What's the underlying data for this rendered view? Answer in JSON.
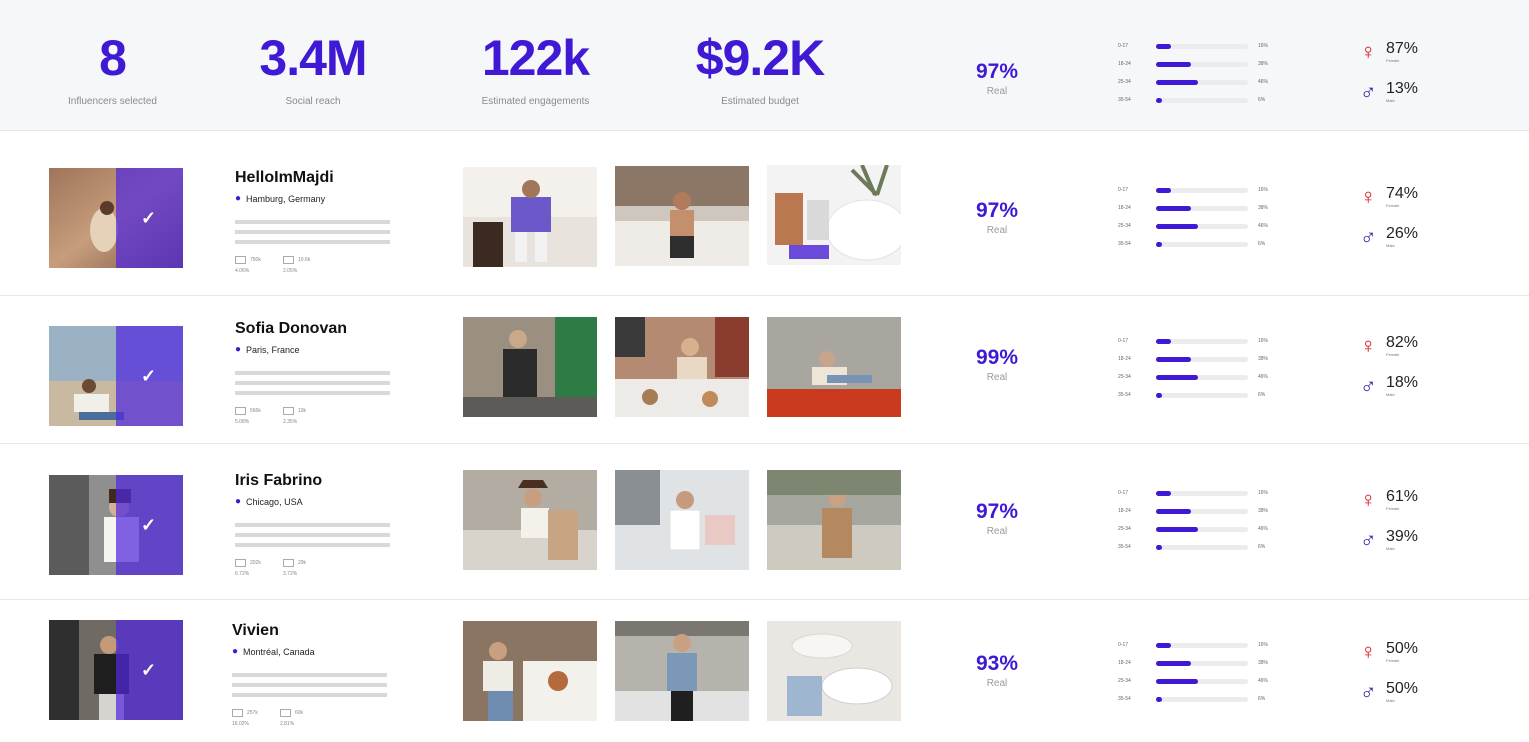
{
  "summary": {
    "influencers_count": "8",
    "influencers_label": "Influencers selected",
    "reach": "3.4M",
    "reach_label": "Social reach",
    "engagements": "122k",
    "engagements_label": "Estimated engagements",
    "budget": "$9.2K",
    "budget_label": "Estimated budget",
    "real_pct": "97%",
    "real_label": "Real",
    "age_groups": [
      {
        "label": "0-17",
        "value": 0.16,
        "pct": "16%"
      },
      {
        "label": "18-24",
        "value": 0.38,
        "pct": "38%"
      },
      {
        "label": "25-34",
        "value": 0.46,
        "pct": "46%"
      },
      {
        "label": "35-54",
        "value": 0.06,
        "pct": "6%"
      }
    ],
    "female_pct": "87%",
    "female_label": "Female",
    "male_pct": "13%",
    "male_label": "Male"
  },
  "influencers": [
    {
      "name": "HelloImMajdi",
      "location": "Hamburg, Germany",
      "metric1_value": "750k",
      "metric1_pct": "4.06%",
      "metric2_value": "10.6k",
      "metric2_pct": "2.05%",
      "real_pct": "97%",
      "real_label": "Real",
      "female_pct": "74%",
      "male_pct": "26%",
      "female_label": "Female",
      "male_label": "Male"
    },
    {
      "name": "Sofia Donovan",
      "location": "Paris, France",
      "metric1_value": "566k",
      "metric1_pct": "5.08%",
      "metric2_value": "10k",
      "metric2_pct": "2.35%",
      "real_pct": "99%",
      "real_label": "Real",
      "female_pct": "82%",
      "male_pct": "18%",
      "female_label": "Female",
      "male_label": "Male"
    },
    {
      "name": "Iris Fabrino",
      "location": "Chicago, USA",
      "metric1_value": "202k",
      "metric1_pct": "6.72%",
      "metric2_value": "29k",
      "metric2_pct": "3.72%",
      "real_pct": "97%",
      "real_label": "Real",
      "female_pct": "61%",
      "male_pct": "39%",
      "female_label": "Female",
      "male_label": "Male"
    },
    {
      "name": "Vivien",
      "location": "Montréal, Canada",
      "metric1_value": "257k",
      "metric1_pct": "16.02%",
      "metric2_value": "60k",
      "metric2_pct": "2.81%",
      "real_pct": "93%",
      "real_label": "Real",
      "female_pct": "50%",
      "male_pct": "50%",
      "female_label": "Female",
      "male_label": "Male"
    }
  ],
  "age_groups": [
    {
      "label": "0-17",
      "value": 0.16,
      "pct": "16%"
    },
    {
      "label": "18-24",
      "value": 0.38,
      "pct": "38%"
    },
    {
      "label": "25-34",
      "value": 0.46,
      "pct": "46%"
    },
    {
      "label": "35-54",
      "value": 0.06,
      "pct": "6%"
    }
  ],
  "icons": {
    "location": "pin-icon",
    "female": "female-symbol-icon",
    "male": "male-symbol-icon",
    "selected": "check-icon"
  },
  "colors": {
    "accent": "#3f19d4",
    "female": "#d4171f",
    "male": "#2c1aa8"
  }
}
